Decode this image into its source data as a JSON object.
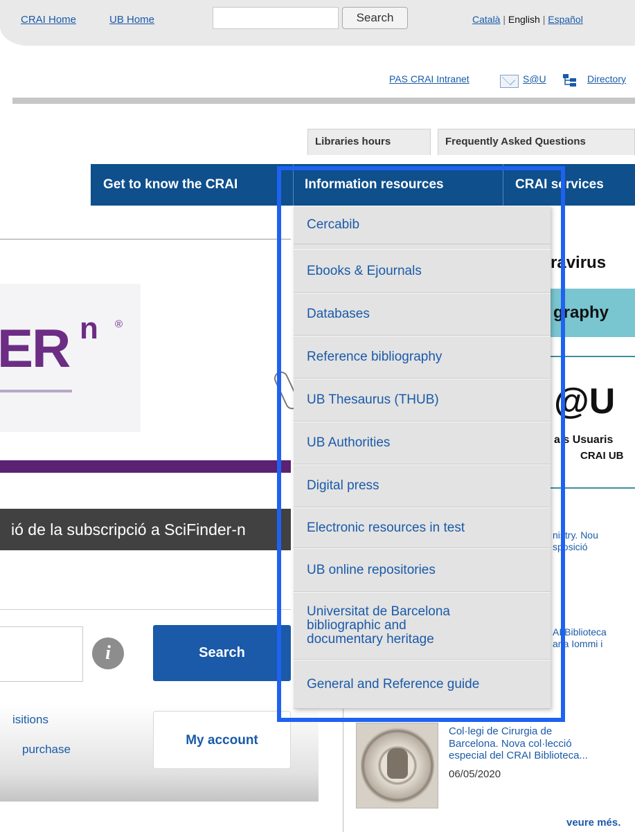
{
  "header": {
    "links": [
      "CRAI Home",
      "UB Home"
    ],
    "search_button": "Search",
    "languages": {
      "ca": "Català",
      "sep": "|",
      "en": "English",
      "es": "Español"
    }
  },
  "secondary_links": {
    "intranet": "PAS CRAI Intranet",
    "sau": "S@U",
    "directory": "Directory"
  },
  "tabs": [
    "Libraries hours",
    "Frequently Asked Questions"
  ],
  "nav": [
    "Get to know the CRAI",
    "Information resources",
    "CRAI services"
  ],
  "dropdown": {
    "items": [
      "Cercabib",
      "Ebooks & Ejournals",
      "Databases",
      "Reference bibliography",
      "UB Thesaurus (THUB)",
      "UB Authorities",
      "Digital press",
      "Electronic resources in test",
      "UB online repositories",
      "Universitat de Barcelona\nbibliographic and\ndocumentary heritage",
      "General and Reference guide"
    ]
  },
  "banner": {
    "logo_text": "ER",
    "logo_sup": "n",
    "logo_reg": "®",
    "caption": "ió de la subscripció a SciFinder-n"
  },
  "catalog": {
    "info_icon": "i",
    "search_button": "Search"
  },
  "quick_links": {
    "acquisitions": "isitions",
    "purchase": "purchase",
    "my_account": "My account"
  },
  "right_column": {
    "covid_title": "ravirus",
    "biblio_title": "graphy",
    "sau_logo": "@U",
    "sau_sub1": "als Usuaris",
    "sau_sub2": "CRAI UB",
    "news_1": "nistry. Nou\nsposició",
    "news_2": "AI Biblioteca\nana Iommi i",
    "news_3_title": "Col·legi de Cirurgia de\nBarcelona. Nova col·lecció\nespecial del CRAI Biblioteca...",
    "news_3_date": "06/05/2020",
    "more": "veure més."
  },
  "colors": {
    "nav_blue": "#0e4f8c",
    "link_blue": "#1a5aa8",
    "highlight": "#1e62f0",
    "brand_purple": "#6c2d84"
  }
}
